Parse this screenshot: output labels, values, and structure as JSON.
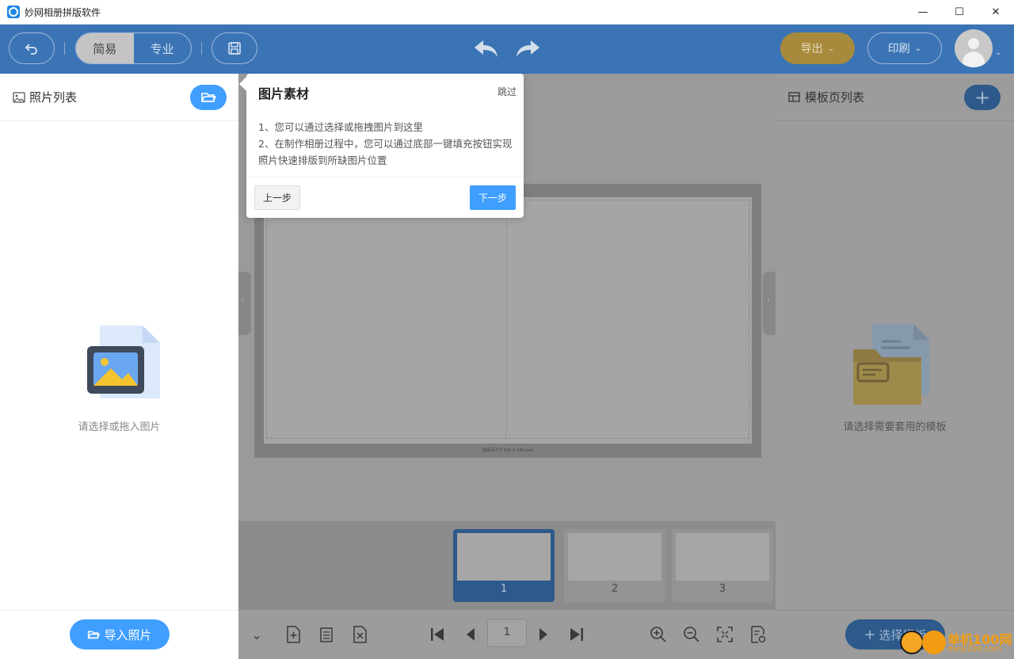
{
  "window": {
    "title": "妙网相册拼版软件",
    "controls": [
      "—",
      "☐",
      "✕"
    ]
  },
  "toolbar": {
    "modes": [
      "简易",
      "专业"
    ],
    "active_mode": "简易",
    "export_label": "导出",
    "print_label": "印刷"
  },
  "left_panel": {
    "title": "照片列表",
    "empty_text": "请选择或拖入图片",
    "import_label": "导入照片"
  },
  "popover": {
    "title": "图片素材",
    "skip": "跳过",
    "line1": "1、您可以通过选择或拖拽图片到这里",
    "line2": "2、在制作相册过程中，您可以通过底部一键填充按钮实现照片快速排版到所缺图片位置",
    "prev": "上一步",
    "next": "下一步"
  },
  "canvas": {
    "caption": "跨版页尺寸 420 × 240 mm"
  },
  "thumbnails": [
    "1",
    "2",
    "3"
  ],
  "active_thumbnail": "1",
  "pager": {
    "current_page": "1"
  },
  "right_panel": {
    "title": "模板页列表",
    "empty_text": "请选择需要套用的模板",
    "select_label": "选择模板"
  },
  "watermark": {
    "text": "单机100网",
    "url": "danji100.com"
  },
  "colors": {
    "toolbar": "#3b74b5",
    "primary": "#409eff",
    "export": "#a88a3c"
  }
}
